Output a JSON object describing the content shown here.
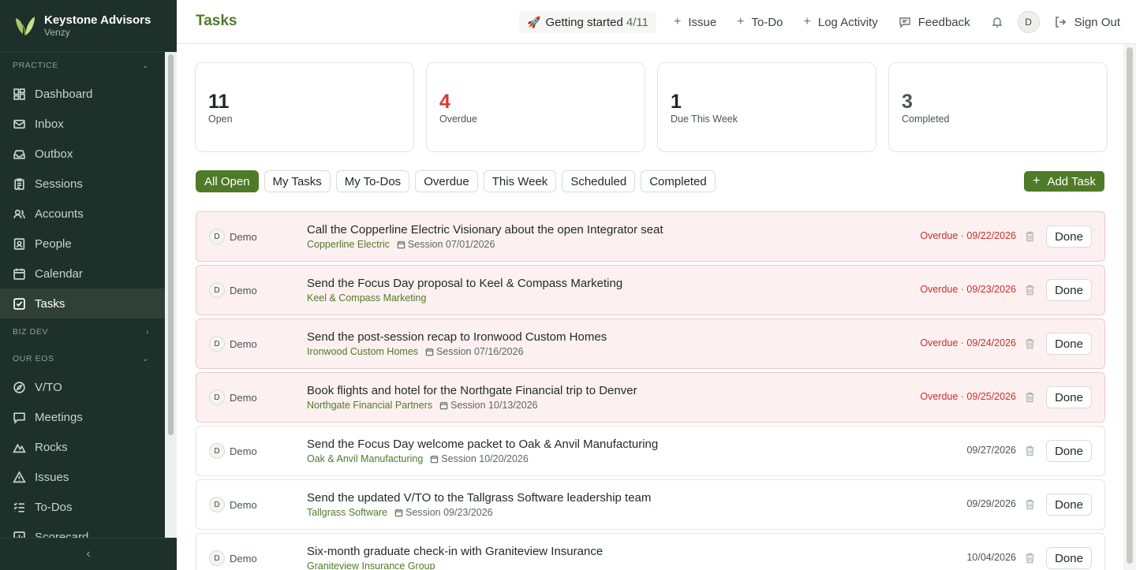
{
  "brand": {
    "name": "Keystone Advisors",
    "sub": "Venzy"
  },
  "sidebar": {
    "practice_label": "PRACTICE",
    "practice_items": [
      {
        "label": "Dashboard",
        "icon": "dashboard-icon"
      },
      {
        "label": "Inbox",
        "icon": "mail-icon"
      },
      {
        "label": "Outbox",
        "icon": "outbox-icon"
      },
      {
        "label": "Sessions",
        "icon": "clipboard-icon"
      },
      {
        "label": "Accounts",
        "icon": "users-icon"
      },
      {
        "label": "People",
        "icon": "id-card-icon"
      },
      {
        "label": "Calendar",
        "icon": "calendar-icon"
      },
      {
        "label": "Tasks",
        "icon": "check-square-icon",
        "active": true
      }
    ],
    "bizdev_label": "BIZ DEV",
    "eos_label": "OUR EOS",
    "eos_items": [
      {
        "label": "V/TO",
        "icon": "compass-icon"
      },
      {
        "label": "Meetings",
        "icon": "chat-icon"
      },
      {
        "label": "Rocks",
        "icon": "mountain-icon"
      },
      {
        "label": "Issues",
        "icon": "warning-icon"
      },
      {
        "label": "To-Dos",
        "icon": "list-check-icon"
      },
      {
        "label": "Scorecard",
        "icon": "scorecard-icon"
      }
    ]
  },
  "header": {
    "title": "Tasks",
    "getting_started_label": "Getting started",
    "getting_started_count": "4/11",
    "issue_label": "Issue",
    "todo_label": "To-Do",
    "log_activity_label": "Log Activity",
    "feedback_label": "Feedback",
    "avatar_initial": "D",
    "sign_out_label": "Sign Out"
  },
  "stats": [
    {
      "value": "11",
      "label": "Open",
      "tone": "default"
    },
    {
      "value": "4",
      "label": "Overdue",
      "tone": "red"
    },
    {
      "value": "1",
      "label": "Due This Week",
      "tone": "default"
    },
    {
      "value": "3",
      "label": "Completed",
      "tone": "muted"
    }
  ],
  "filters": [
    "All Open",
    "My Tasks",
    "My To-Dos",
    "Overdue",
    "This Week",
    "Scheduled",
    "Completed"
  ],
  "active_filter": "All Open",
  "add_task_label": "Add Task",
  "tasks": [
    {
      "assignee_initial": "D",
      "assignee": "Demo",
      "title": "Call the Copperline Electric Visionary about the open Integrator seat",
      "account": "Copperline Electric",
      "session": "Session 07/01/2026",
      "due": "Overdue · 09/22/2026",
      "overdue": true,
      "done_label": "Done"
    },
    {
      "assignee_initial": "D",
      "assignee": "Demo",
      "title": "Send the Focus Day proposal to Keel & Compass Marketing",
      "account": "Keel & Compass Marketing",
      "session": "",
      "due": "Overdue · 09/23/2026",
      "overdue": true,
      "done_label": "Done"
    },
    {
      "assignee_initial": "D",
      "assignee": "Demo",
      "title": "Send the post-session recap to Ironwood Custom Homes",
      "account": "Ironwood Custom Homes",
      "session": "Session 07/16/2026",
      "due": "Overdue · 09/24/2026",
      "overdue": true,
      "done_label": "Done"
    },
    {
      "assignee_initial": "D",
      "assignee": "Demo",
      "title": "Book flights and hotel for the Northgate Financial trip to Denver",
      "account": "Northgate Financial Partners",
      "session": "Session 10/13/2026",
      "due": "Overdue · 09/25/2026",
      "overdue": true,
      "done_label": "Done"
    },
    {
      "assignee_initial": "D",
      "assignee": "Demo",
      "title": "Send the Focus Day welcome packet to Oak & Anvil Manufacturing",
      "account": "Oak & Anvil Manufacturing",
      "session": "Session 10/20/2026",
      "due": "09/27/2026",
      "overdue": false,
      "done_label": "Done"
    },
    {
      "assignee_initial": "D",
      "assignee": "Demo",
      "title": "Send the updated V/TO to the Tallgrass Software leadership team",
      "account": "Tallgrass Software",
      "session": "Session 09/23/2026",
      "due": "09/29/2026",
      "overdue": false,
      "done_label": "Done"
    },
    {
      "assignee_initial": "D",
      "assignee": "Demo",
      "title": "Six-month graduate check-in with Graniteview Insurance",
      "account": "Graniteview Insurance Group",
      "session": "",
      "due": "10/04/2026",
      "overdue": false,
      "done_label": "Done"
    }
  ],
  "colors": {
    "brand_green": "#4f7a28",
    "sidebar_bg": "#1d3029",
    "overdue_red": "#d73a3a",
    "overdue_row_bg": "#fdf0f0"
  }
}
